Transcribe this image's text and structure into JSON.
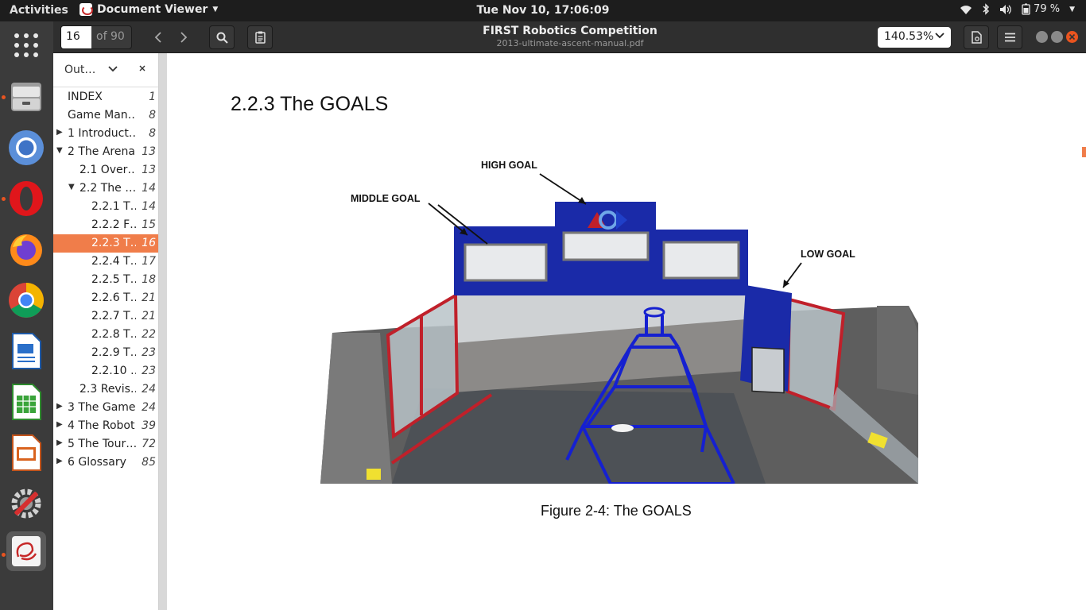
{
  "topbar": {
    "activities": "Activities",
    "app_name": "Document Viewer",
    "clock": "Tue Nov 10, 17:06:09",
    "battery": "79 %"
  },
  "dock": [
    "show-apps",
    "files",
    "chromium",
    "opera",
    "firefox",
    "chrome",
    "writer",
    "calc",
    "impress",
    "settings",
    "document-viewer"
  ],
  "header": {
    "page_current": "16",
    "page_total": "of 90",
    "title": "FIRST Robotics Competition",
    "filename": "2013-ultimate-ascent-manual.pdf",
    "zoom": "140.53%"
  },
  "sidebar": {
    "mode_label": "Out…",
    "items": [
      {
        "label": "INDEX",
        "page": "1",
        "level": 0,
        "expander": "none"
      },
      {
        "label": "Game Man…",
        "page": "8",
        "level": 0,
        "expander": "none"
      },
      {
        "label": "1 Introduct…",
        "page": "8",
        "level": 0,
        "expander": "collapsed"
      },
      {
        "label": "2 The Arena",
        "page": "13",
        "level": 0,
        "expander": "expanded"
      },
      {
        "label": "2.1 Over…",
        "page": "13",
        "level": 1,
        "expander": "none"
      },
      {
        "label": "2.2 The …",
        "page": "14",
        "level": 1,
        "expander": "expanded"
      },
      {
        "label": "2.2.1 T…",
        "page": "14",
        "level": 2,
        "expander": "none"
      },
      {
        "label": "2.2.2 F…",
        "page": "15",
        "level": 2,
        "expander": "none"
      },
      {
        "label": "2.2.3 T…",
        "page": "16",
        "level": 2,
        "expander": "none",
        "selected": true
      },
      {
        "label": "2.2.4 T…",
        "page": "17",
        "level": 2,
        "expander": "none"
      },
      {
        "label": "2.2.5 T…",
        "page": "18",
        "level": 2,
        "expander": "none"
      },
      {
        "label": "2.2.6 T…",
        "page": "21",
        "level": 2,
        "expander": "none"
      },
      {
        "label": "2.2.7 T…",
        "page": "21",
        "level": 2,
        "expander": "none"
      },
      {
        "label": "2.2.8 T…",
        "page": "22",
        "level": 2,
        "expander": "none"
      },
      {
        "label": "2.2.9 T…",
        "page": "23",
        "level": 2,
        "expander": "none"
      },
      {
        "label": "2.2.10 …",
        "page": "23",
        "level": 2,
        "expander": "none"
      },
      {
        "label": "2.3 Revis…",
        "page": "24",
        "level": 1,
        "expander": "none"
      },
      {
        "label": "3 The Game",
        "page": "24",
        "level": 0,
        "expander": "collapsed"
      },
      {
        "label": "4 The Robot",
        "page": "39",
        "level": 0,
        "expander": "collapsed"
      },
      {
        "label": "5 The Tour…",
        "page": "72",
        "level": 0,
        "expander": "collapsed"
      },
      {
        "label": "6 Glossary",
        "page": "85",
        "level": 0,
        "expander": "collapsed"
      }
    ]
  },
  "document": {
    "section_title": "2.2.3 The GOALS",
    "figure_labels": {
      "high": "HIGH GOAL",
      "middle": "MIDDLE GOAL",
      "low": "LOW GOAL"
    },
    "caption": "Figure 2-4: The GOALS"
  },
  "colors": {
    "accent": "#f07d4a",
    "goal_blue": "#1a2aa8",
    "frame_red": "#c0202a"
  }
}
